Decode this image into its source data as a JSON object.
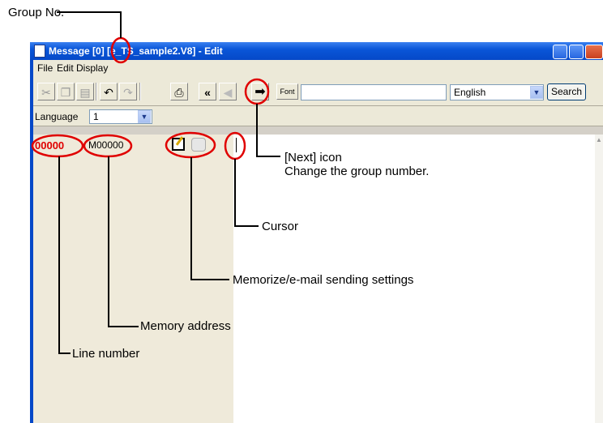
{
  "callouts": {
    "group_no": "Group No.",
    "next_icon_line1": "[Next] icon",
    "next_icon_line2": "Change the group number.",
    "cursor": "Cursor",
    "memorize": "Memorize/e-mail sending settings",
    "memory_address": "Memory address",
    "line_number": "Line number"
  },
  "window": {
    "title": "Message [0] [e_TS_sample2.V8] - Edit"
  },
  "menu": [
    "File",
    "Edit",
    "Display"
  ],
  "toolbar": {
    "font_label": "Font",
    "search_value": "",
    "language_option": "English",
    "search_label": "Search"
  },
  "language_row": {
    "label": "Language",
    "value": "1"
  },
  "content": {
    "line_number": "00000",
    "memory_address": "M00000"
  },
  "colors": {
    "annotation_red": "#e00000",
    "titlebar_blue": "#0a56d8",
    "gutter": "#efeada"
  },
  "icons": [
    "cut-icon",
    "copy-icon",
    "paste-icon",
    "undo-icon",
    "redo-icon",
    "print-icon",
    "previous-group-icon",
    "back-icon",
    "next-icon",
    "memorize-icon",
    "email-settings-icon"
  ]
}
